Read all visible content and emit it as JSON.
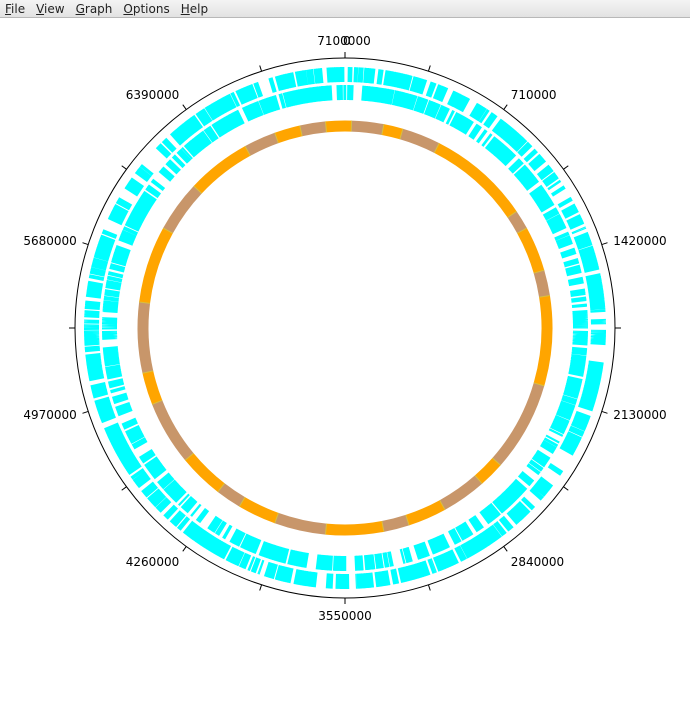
{
  "menubar": {
    "items": [
      {
        "label": "File",
        "accel": "F",
        "rest": "ile"
      },
      {
        "label": "View",
        "accel": "V",
        "rest": "iew"
      },
      {
        "label": "Graph",
        "accel": "G",
        "rest": "raph"
      },
      {
        "label": "Options",
        "accel": "O",
        "rest": "ptions"
      },
      {
        "label": "Help",
        "accel": "H",
        "rest": "elp"
      }
    ]
  },
  "genome_map": {
    "genome_length": 7100000,
    "tick_labels": [
      {
        "position": 0,
        "text": "0"
      },
      {
        "position": 7100000,
        "text": "7100000"
      },
      {
        "position": 710000,
        "text": "710000"
      },
      {
        "position": 1420000,
        "text": "1420000"
      },
      {
        "position": 2130000,
        "text": "2130000"
      },
      {
        "position": 2840000,
        "text": "2840000"
      },
      {
        "position": 3550000,
        "text": "3550000"
      },
      {
        "position": 4260000,
        "text": "4260000"
      },
      {
        "position": 4970000,
        "text": "4970000"
      },
      {
        "position": 5680000,
        "text": "5680000"
      },
      {
        "position": 6390000,
        "text": "6390000"
      }
    ],
    "minor_tick_count": 20,
    "colors": {
      "frame": "#000000",
      "feature_track": "#00ffff",
      "gc_high": "#ffa500",
      "gc_low": "#c8966a",
      "gc_boundary": "#d8c040"
    },
    "gc_band_boundaries": [
      0.0,
      0.005,
      0.03,
      0.045,
      0.075,
      0.155,
      0.17,
      0.205,
      0.225,
      0.295,
      0.365,
      0.385,
      0.42,
      0.45,
      0.47,
      0.515,
      0.555,
      0.585,
      0.605,
      0.64,
      0.69,
      0.715,
      0.77,
      0.83,
      0.87,
      0.92,
      0.945,
      0.965,
      0.985,
      1.0
    ]
  }
}
